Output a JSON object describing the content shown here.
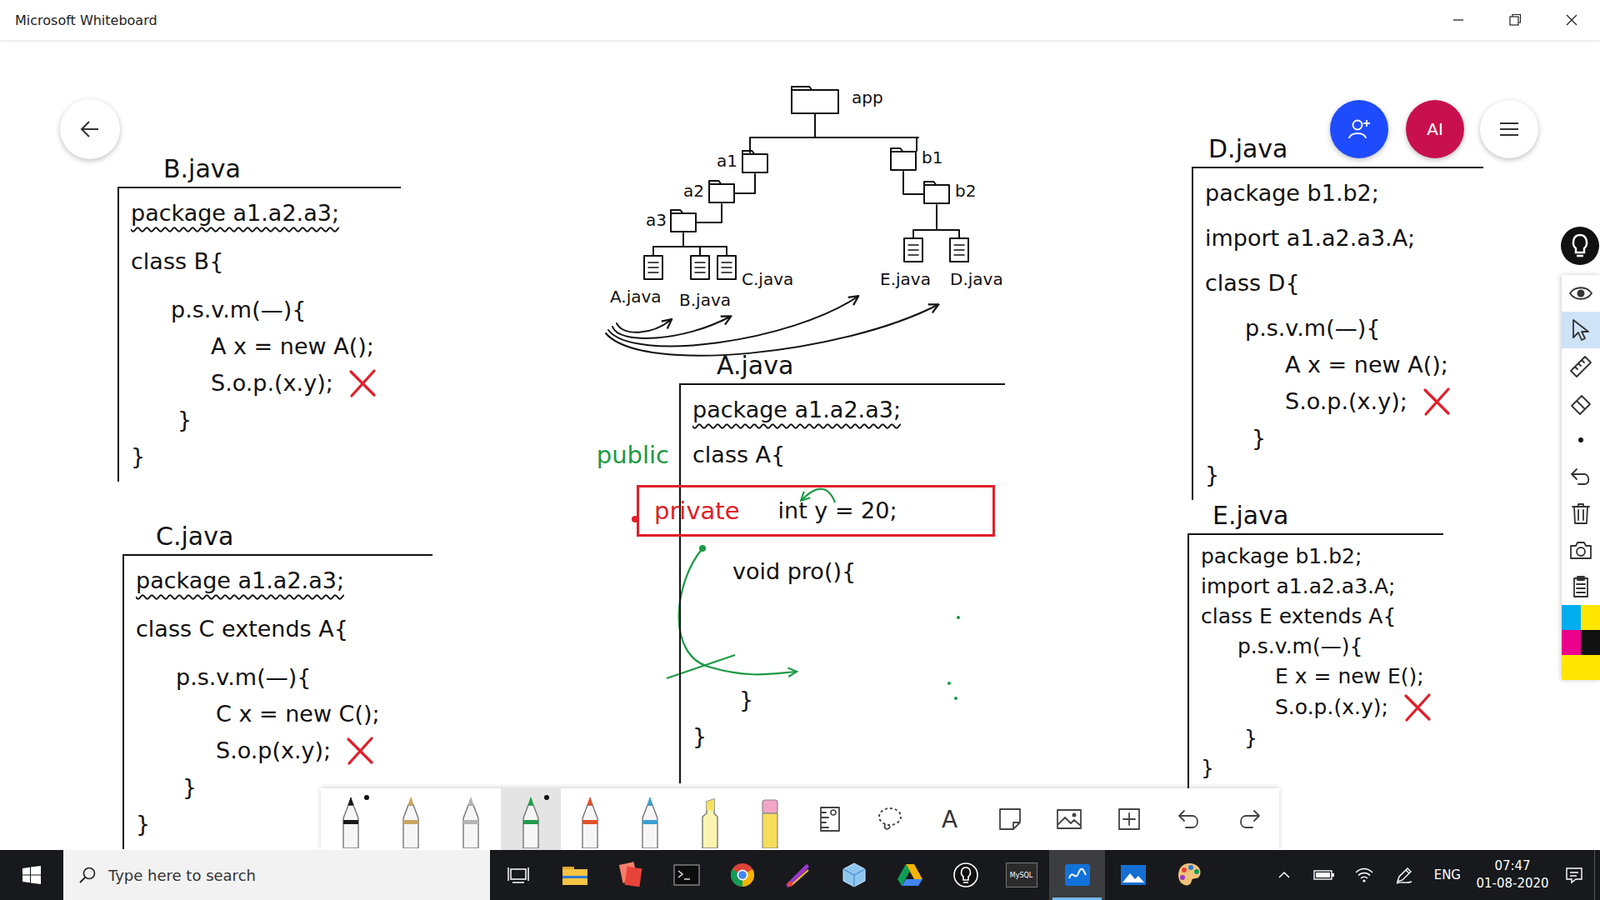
{
  "window": {
    "title": "Microsoft Whiteboard"
  },
  "header": {
    "avatar": "AI"
  },
  "diagram": {
    "nodes": [
      {
        "label": "app",
        "kind": "folder"
      },
      {
        "label": "a1",
        "kind": "folder"
      },
      {
        "label": "a2",
        "kind": "folder"
      },
      {
        "label": "a3",
        "kind": "folder"
      },
      {
        "label": "A.java",
        "kind": "file"
      },
      {
        "label": "B.java",
        "kind": "file"
      },
      {
        "label": "C.java",
        "kind": "file"
      },
      {
        "label": "b1",
        "kind": "folder"
      },
      {
        "label": "b2",
        "kind": "folder"
      },
      {
        "label": "E.java",
        "kind": "file"
      },
      {
        "label": "D.java",
        "kind": "file"
      }
    ]
  },
  "notes": [
    {
      "title": "B.java",
      "package_underlined": true,
      "lines": [
        {
          "text": "package a1.a2.a3;",
          "kind": "head",
          "error": false
        },
        {
          "text": "class B{",
          "kind": "head",
          "error": false
        },
        {
          "text": "p.s.v.m(—){",
          "kind": "method",
          "error": false
        },
        {
          "text": "A x = new A();",
          "kind": "stmt",
          "error": false
        },
        {
          "text": "S.o.p.(x.y);",
          "kind": "stmt",
          "error": true
        },
        {
          "text": "}",
          "kind": "close-method",
          "error": false
        },
        {
          "text": "}",
          "kind": "close-class",
          "error": false
        }
      ]
    },
    {
      "title": "C.java",
      "package_underlined": true,
      "lines": [
        {
          "text": "package a1.a2.a3;",
          "kind": "head",
          "error": false
        },
        {
          "text": "class C extends A{",
          "kind": "head",
          "error": false
        },
        {
          "text": "p.s.v.m(—){",
          "kind": "method",
          "error": false
        },
        {
          "text": "C x = new C();",
          "kind": "stmt",
          "error": false
        },
        {
          "text": "S.o.p(x.y);",
          "kind": "stmt",
          "error": true
        },
        {
          "text": "}",
          "kind": "close-method",
          "error": false
        },
        {
          "text": "}",
          "kind": "close-class",
          "error": false
        }
      ]
    },
    {
      "title": "A.java",
      "package_underlined": true,
      "lines": [
        {
          "text": "package a1.a2.a3;",
          "kind": "head",
          "error": false
        },
        {
          "text": "class A{",
          "kind": "head",
          "error": false,
          "annotation": "public"
        },
        {
          "text": "int y = 20;",
          "kind": "field",
          "error": false,
          "modifier": "private"
        },
        {
          "text": "void pro(){",
          "kind": "method",
          "error": false
        },
        {
          "text": "}",
          "kind": "close-method",
          "error": false
        },
        {
          "text": "}",
          "kind": "close-class",
          "error": false
        }
      ]
    },
    {
      "title": "D.java",
      "package_underlined": false,
      "lines": [
        {
          "text": "package b1.b2;",
          "kind": "head",
          "error": false
        },
        {
          "text": "import a1.a2.a3.A;",
          "kind": "head",
          "error": false
        },
        {
          "text": "class D{",
          "kind": "head",
          "error": false
        },
        {
          "text": "p.s.v.m(—){",
          "kind": "method",
          "error": false
        },
        {
          "text": "A x = new A();",
          "kind": "stmt",
          "error": false
        },
        {
          "text": "S.o.p.(x.y);",
          "kind": "stmt",
          "error": true
        },
        {
          "text": "}",
          "kind": "close-method",
          "error": false
        },
        {
          "text": "}",
          "kind": "close-class",
          "error": false
        }
      ]
    },
    {
      "title": "E.java",
      "package_underlined": false,
      "lines": [
        {
          "text": "package b1.b2;",
          "kind": "head",
          "error": false
        },
        {
          "text": "import a1.a2.a3.A;",
          "kind": "head",
          "error": false
        },
        {
          "text": "class E extends A{",
          "kind": "head",
          "error": false
        },
        {
          "text": "p.s.v.m(—){",
          "kind": "method",
          "error": false
        },
        {
          "text": "E x = new E();",
          "kind": "stmt",
          "error": false
        },
        {
          "text": "S.o.p.(x.y);",
          "kind": "stmt",
          "error": true
        },
        {
          "text": "}",
          "kind": "close-method",
          "error": false
        },
        {
          "text": "}",
          "kind": "close-class",
          "error": false
        }
      ]
    }
  ],
  "tools": [
    {
      "kind": "pen",
      "color": "#1a1a1a",
      "selected": false,
      "dot": true
    },
    {
      "kind": "pen",
      "color": "#c9a45c",
      "selected": false,
      "dot": false
    },
    {
      "kind": "pen",
      "color": "#b5b5b5",
      "selected": false,
      "dot": false
    },
    {
      "kind": "pen",
      "color": "#1f9e4a",
      "selected": true,
      "dot": true
    },
    {
      "kind": "pen",
      "color": "#e0502a",
      "selected": false,
      "dot": false
    },
    {
      "kind": "pen",
      "color": "#3a9fd0",
      "selected": false,
      "dot": false
    },
    {
      "kind": "highlighter",
      "color": "#f7e35a",
      "selected": false,
      "dot": false
    },
    {
      "kind": "eraser",
      "color": "#f3a6c8",
      "selected": false,
      "dot": false
    },
    {
      "kind": "ruler",
      "selected": false,
      "dot": false
    },
    {
      "kind": "lasso",
      "selected": false,
      "dot": false
    },
    {
      "kind": "text",
      "label": "A",
      "selected": false,
      "dot": false
    },
    {
      "kind": "note",
      "selected": false,
      "dot": false
    },
    {
      "kind": "image",
      "selected": false,
      "dot": false
    },
    {
      "kind": "add",
      "selected": false,
      "dot": false
    },
    {
      "kind": "undo",
      "selected": false,
      "dot": false
    },
    {
      "kind": "redo",
      "selected": false,
      "dot": false
    }
  ],
  "side_tools": [
    {
      "kind": "eye",
      "selected": false
    },
    {
      "kind": "pointer",
      "selected": true
    },
    {
      "kind": "ruler",
      "selected": false
    },
    {
      "kind": "eraser",
      "selected": false
    },
    {
      "kind": "dot",
      "selected": false
    },
    {
      "kind": "undo",
      "selected": false
    },
    {
      "kind": "trash",
      "selected": false
    },
    {
      "kind": "camera",
      "selected": false
    },
    {
      "kind": "clipboard",
      "selected": false
    }
  ],
  "swatches": [
    {
      "color": "#00aeef"
    },
    {
      "color": "#ffe600"
    },
    {
      "color": "#ec008c"
    },
    {
      "color": "#111111"
    },
    {
      "color": "#ffe600"
    },
    {
      "color": "#ffe600"
    }
  ],
  "taskbar": {
    "search_placeholder": "Type here to search",
    "mysql_label": "MySQL",
    "language": "ENG",
    "time": "07:47",
    "date": "01-08-2020",
    "apps": [
      {
        "active": false
      },
      {
        "active": false
      },
      {
        "active": false
      },
      {
        "active": false
      },
      {
        "active": false
      },
      {
        "active": false
      },
      {
        "active": false
      },
      {
        "active": false
      },
      {
        "active": false
      },
      {
        "active": true
      },
      {
        "active": false
      },
      {
        "active": false
      }
    ]
  }
}
